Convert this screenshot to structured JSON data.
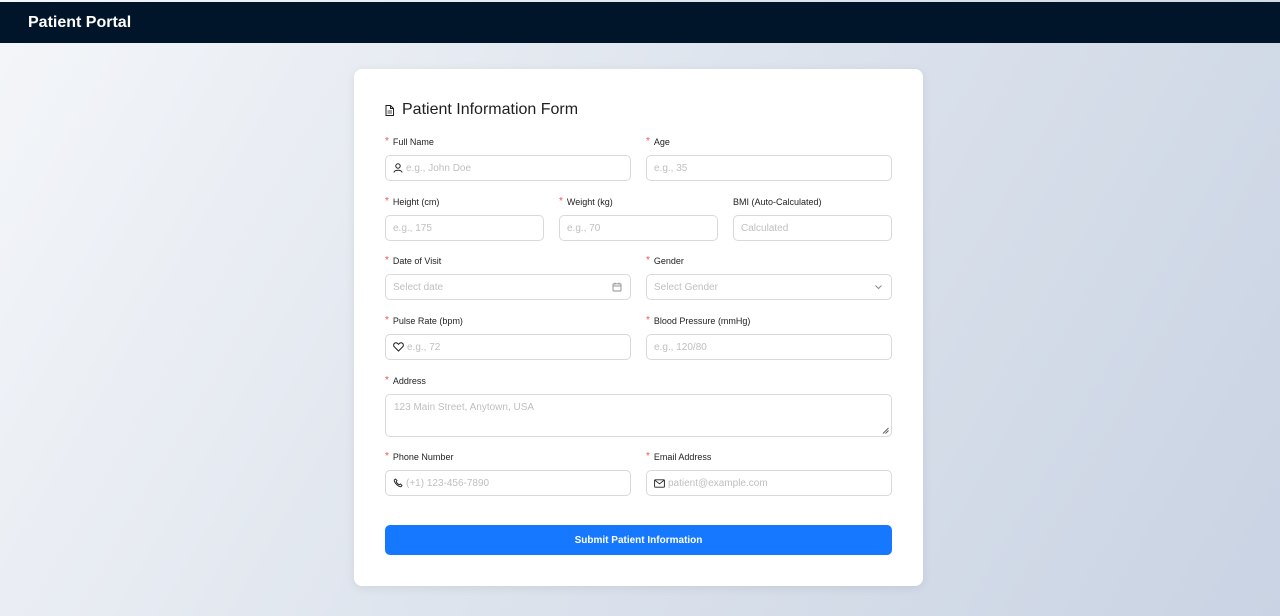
{
  "header": {
    "brand": "Patient Portal"
  },
  "form": {
    "title": "Patient Information Form",
    "title_icon": "file-icon",
    "fields": {
      "full_name": {
        "label": "Full Name",
        "required": true,
        "placeholder": "e.g., John Doe",
        "icon": "user-icon"
      },
      "age": {
        "label": "Age",
        "required": true,
        "placeholder": "e.g., 35"
      },
      "height": {
        "label": "Height (cm)",
        "required": true,
        "placeholder": "e.g., 175"
      },
      "weight": {
        "label": "Weight (kg)",
        "required": true,
        "placeholder": "e.g., 70"
      },
      "bmi": {
        "label": "BMI (Auto-Calculated)",
        "required": false,
        "placeholder": "Calculated"
      },
      "date_of_visit": {
        "label": "Date of Visit",
        "required": true,
        "placeholder": "Select date",
        "icon": "calendar-icon"
      },
      "gender": {
        "label": "Gender",
        "required": true,
        "placeholder": "Select Gender",
        "icon": "chevron-down-icon"
      },
      "pulse_rate": {
        "label": "Pulse Rate (bpm)",
        "required": true,
        "placeholder": "e.g., 72",
        "icon": "heart-icon"
      },
      "blood_pressure": {
        "label": "Blood Pressure (mmHg)",
        "required": true,
        "placeholder": "e.g., 120/80"
      },
      "address": {
        "label": "Address",
        "required": true,
        "placeholder": "123 Main Street, Anytown, USA"
      },
      "phone": {
        "label": "Phone Number",
        "required": true,
        "placeholder": "(+1) 123-456-7890",
        "icon": "phone-icon"
      },
      "email": {
        "label": "Email Address",
        "required": true,
        "placeholder": "patient@example.com",
        "icon": "mail-icon"
      }
    },
    "submit_label": "Submit Patient Information"
  },
  "colors": {
    "header_bg": "#001529",
    "primary": "#1677ff",
    "required_mark": "#ff4d4f",
    "placeholder": "#bfbfbf",
    "border": "#d9d9d9"
  }
}
